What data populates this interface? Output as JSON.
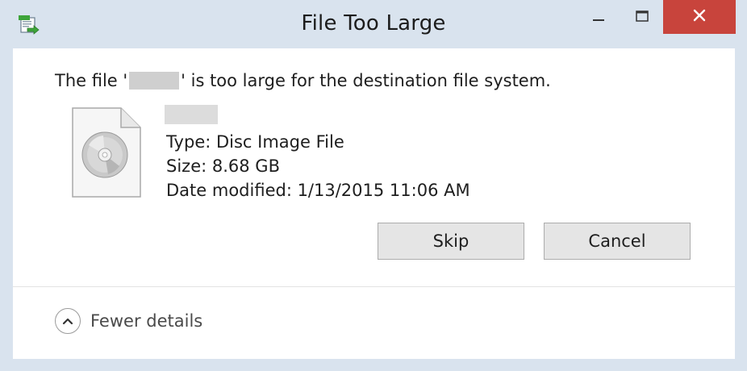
{
  "window": {
    "title": "File Too Large"
  },
  "message": {
    "prefix": "The file '",
    "suffix": "' is too large for the destination file system."
  },
  "details": {
    "type": "Type: Disc Image File",
    "size": "Size: 8.68 GB",
    "date_modified": "Date modified: 1/13/2015 11:06 AM"
  },
  "buttons": {
    "skip": "Skip",
    "cancel": "Cancel"
  },
  "footer": {
    "fewer_details": "Fewer details"
  },
  "icons": {
    "app": "move-file-icon",
    "file": "disc-image-file-icon",
    "minimize": "minimize-icon",
    "maximize": "maximize-icon",
    "close": "close-icon",
    "collapse": "chevron-up-icon"
  },
  "colors": {
    "titlebar": "#d9e3ee",
    "close_button": "#c8443c",
    "button_face": "#e5e5e5"
  }
}
